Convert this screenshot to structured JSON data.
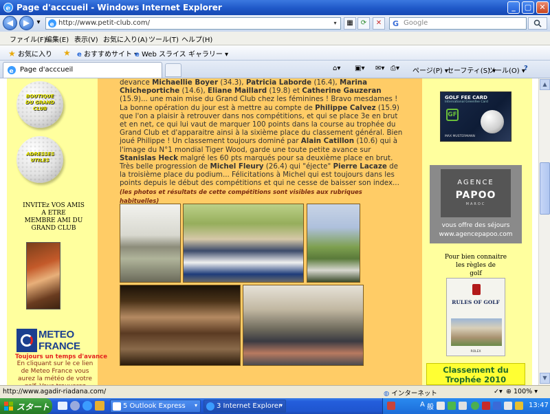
{
  "window": {
    "title": "Page d'acccueil - Windows Internet Explorer"
  },
  "address": {
    "url": "http://www.petit-club.com/"
  },
  "search": {
    "placeholder": "Google"
  },
  "menu": [
    "ファイル(F)",
    "編集(E)",
    "表示(V)",
    "お気に入り(A)",
    "ツール(T)",
    "ヘルプ(H)"
  ],
  "favorites": {
    "label": "お気に入り",
    "suggested": "おすすめサイト ▾",
    "gallery": "Web スライス ギャラリー ▾"
  },
  "tab": {
    "label": "Page d'acccueil"
  },
  "tab_tools": {
    "page": "ページ(P) ▾",
    "safety": "セーフティ(S) ▾",
    "tools": "ツール(O) ▾",
    "help": "?"
  },
  "left": {
    "ball1": "BOUTIQUE DU GRAND CLUB",
    "ball2": "ADRESSES UTILES",
    "invite": [
      "INVITEz VOS AMIS",
      "A ETRE",
      "MEMBRE AMI DU",
      "GRAND CLUB"
    ],
    "meteo_line1": "METEO",
    "meteo_line2": "FRANCE",
    "meteo_tag": "Toujours un temps d'avance",
    "meteo_desc": "En cliquant sur le ce lien de Meteo France vous aurez la météo de votre golf. Vous trouverez"
  },
  "article": {
    "p1_a": "devance ",
    "n1": "Michaellie Boyer",
    "p1_b": " (34.3), ",
    "n2": "Patricia Laborde",
    "p1_c": " (16.4), ",
    "n3": "Marina Chicheportiche",
    "p1_d": " (14.6), ",
    "n4": "Eliane Maillard",
    "p1_e": " (19.8) et ",
    "n5": "Catherine Gauzeran",
    "p1_f": " (15.9)... une main mise du Grand Club chez les féminines ! Bravo mesdames ! La bonne opération du jour est à mettre au compte de ",
    "n6": "Philippe Calvez",
    "p1_g": " (15.9) que l'on a plaisir à retrouver dans nos compétitions, et qui se place 3e en brut et en net, ce qui lui vaut de marquer 100 points dans la course au trophée du Grand Club et d'apparaitre ainsi à la sixième place du classement général. Bien joué Philippe ! Un classement toujours dominé par ",
    "n7": "Alain Catillon",
    "p1_h": " (10.6) qui à l'image du N°1 mondial Tiger Wood, garde une toute petite avance sur ",
    "n8": "Stanislas Heck",
    "p1_i": " malgré les 60 pts marqués pour sa deuxième place en brut. Très belle progression de ",
    "n9": "Michel Fleury",
    "p1_j": " (26.4) qui \"éjecte\" ",
    "n10": "Pierre Lacaze",
    "p1_k": " de la troisième place du podium... Félicitations à Michel qui est toujours dans les points depuis le début des compétitions et qui ne cesse de baisser son index...",
    "caption": "(les photos et résultats de cette compétitions sont visibles aux rubriques habituelles)"
  },
  "right": {
    "golfcard_title": "GOLF FEE CARD",
    "golfcard_sub": "International Greenfee Card",
    "golfcard_holder": "MAX MUSTERMANN",
    "agence_1": "AGENCE",
    "agence_2": "PAPOO",
    "agence_3": "MAROC",
    "agence_offer": "vous offre des séjours",
    "agence_url": "www.agencepapoo.com",
    "rules_intro": [
      "Pour bien connaitre",
      "les règles de",
      "golf"
    ],
    "rules_title": "RULES OF GOLF",
    "rules_brand": "ROLEX",
    "classement": [
      "Classement du",
      "Trophée 2010"
    ]
  },
  "status": {
    "url": "http://www.agadir-riadana.com/",
    "zone": "インターネット",
    "zoom": "100%"
  },
  "taskbar": {
    "start": "スタート",
    "item1": "5 Outlook Express",
    "item2": "3 Internet Explorer",
    "ime1": "A",
    "ime2": "般",
    "clock": "13:47"
  }
}
